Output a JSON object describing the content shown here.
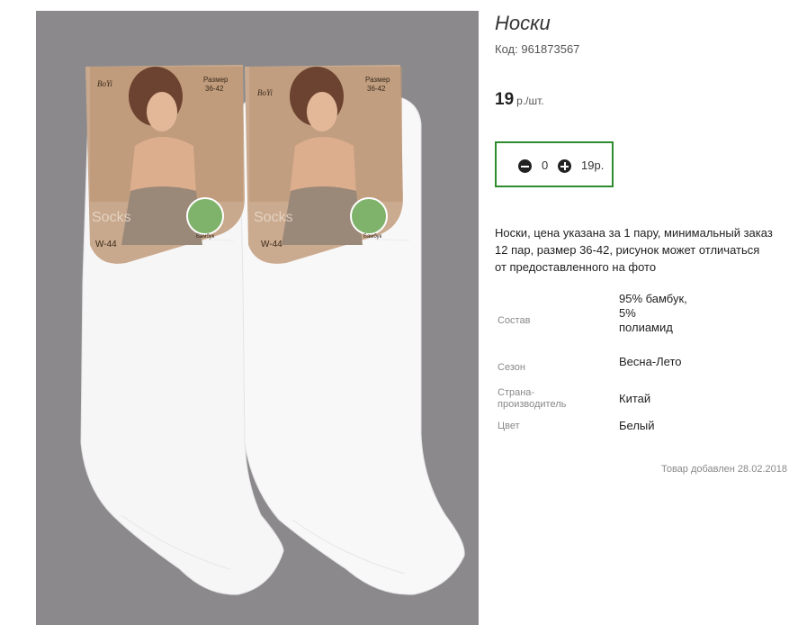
{
  "product": {
    "title": "Носки",
    "code_label": "Код:",
    "code_value": "961873567",
    "price": "19",
    "price_unit": "р./шт.",
    "description": "Носки, цена указана за 1 пару, минимальный заказ 12 пар, размер 36-42, рисунок может отличаться от предоставленного на фото",
    "added": "Товар добавлен 28.02.2018"
  },
  "cart": {
    "quantity": "0",
    "sum": "19р.",
    "minus_icon": "minus-circle-icon",
    "plus_icon": "plus-circle-icon"
  },
  "photo": {
    "label_left_brand": "BoYi",
    "label_right_brand": "BoYi",
    "size_label": "Размер",
    "size_value": "36-42",
    "model": "W-44",
    "material_tag": "Бамбук",
    "socks_text": "Socks",
    "bg_color": "#8b898c"
  },
  "properties": [
    {
      "label": "Состав",
      "value": "95% бамбук, 5% полиамид"
    },
    {
      "label": "Сезон",
      "value": "Весна-Лето"
    },
    {
      "label": "Страна-производитель",
      "value": "Китай"
    },
    {
      "label": "Цвет",
      "value": "Белый"
    }
  ]
}
